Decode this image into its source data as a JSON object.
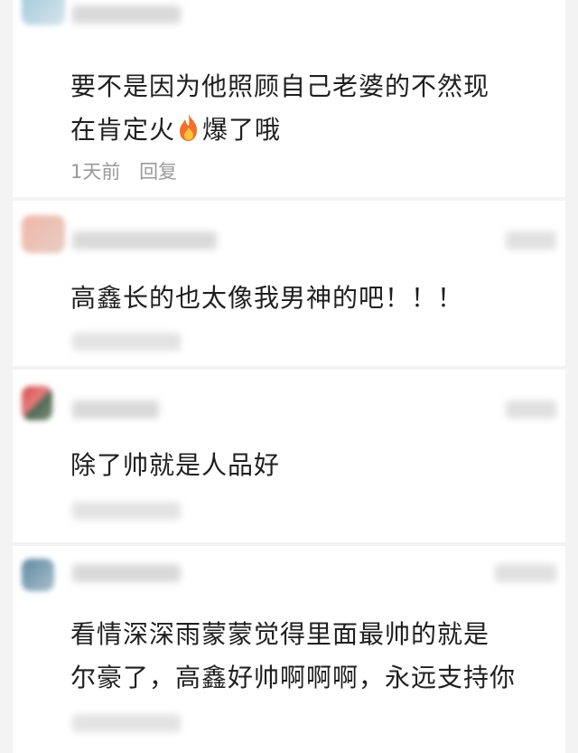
{
  "comments": [
    {
      "text_line1": "要不是因为他照顾自己老婆的不然现",
      "text_line2_before": "在肯定火",
      "emoji": "fire-emoji",
      "text_line2_after": "爆了哦",
      "time": "1天前",
      "reply": "回复"
    },
    {
      "text": "高鑫长的也太像我男神的吧！！！"
    },
    {
      "text": "除了帅就是人品好"
    },
    {
      "text_line1": "看情深深雨蒙蒙觉得里面最帅的就是",
      "text_line2": "尔豪了，高鑫好帅啊啊啊，永远支持你"
    }
  ],
  "colors": {
    "background": "#f3f3f3",
    "card": "#ffffff",
    "comment_text": "#1f1f1f",
    "meta_text": "#9a9a9a",
    "fire_outer": "#f2702a",
    "fire_inner": "#ffc23d"
  }
}
